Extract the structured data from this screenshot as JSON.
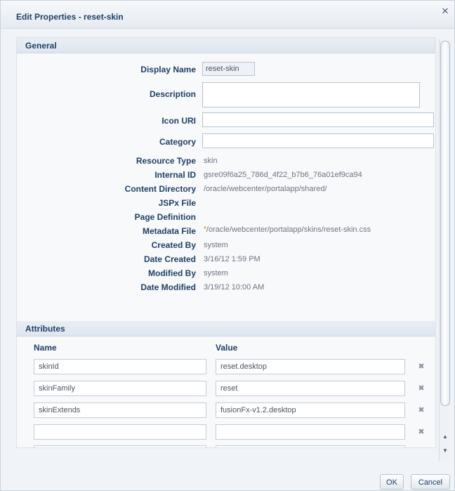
{
  "dialog": {
    "title": "Edit Properties - reset-skin",
    "close_glyph": "✕",
    "ok_label": "OK",
    "cancel_label": "Cancel"
  },
  "general": {
    "header": "General",
    "display_name_label": "Display Name",
    "display_name_value": "reset-skin",
    "description_label": "Description",
    "description_value": "",
    "icon_uri_label": "Icon URI",
    "icon_uri_value": "",
    "category_label": "Category",
    "category_value": "",
    "resource_type_label": "Resource Type",
    "resource_type_value": "skin",
    "internal_id_label": "Internal ID",
    "internal_id_value": "gsre09f6a25_786d_4f22_b7b6_76a01ef9ca94",
    "content_directory_label": "Content Directory",
    "content_directory_value": "/oracle/webcenter/portalapp/shared/",
    "jspx_file_label": "JSPx File",
    "jspx_file_value": "",
    "page_definition_label": "Page Definition",
    "page_definition_value": "",
    "metadata_file_label": "Metadata File",
    "metadata_file_required": "*",
    "metadata_file_value": "/oracle/webcenter/portalapp/skins/reset-skin.css",
    "created_by_label": "Created By",
    "created_by_value": "system",
    "date_created_label": "Date Created",
    "date_created_value": "3/16/12 1:59 PM",
    "modified_by_label": "Modified By",
    "modified_by_value": "system",
    "date_modified_label": "Date Modified",
    "date_modified_value": "3/19/12 10:00 AM"
  },
  "attributes": {
    "header": "Attributes",
    "col_name": "Name",
    "col_value": "Value",
    "delete_glyph": "✖",
    "rows": [
      {
        "name": "skinId",
        "value": "reset.desktop"
      },
      {
        "name": "skinFamily",
        "value": "reset"
      },
      {
        "name": "skinExtends",
        "value": "fusionFx-v1.2.desktop"
      },
      {
        "name": "",
        "value": ""
      },
      {
        "name": "",
        "value": ""
      }
    ]
  },
  "scrollbar": {
    "up_glyph": "▲",
    "down_glyph": "▼"
  }
}
